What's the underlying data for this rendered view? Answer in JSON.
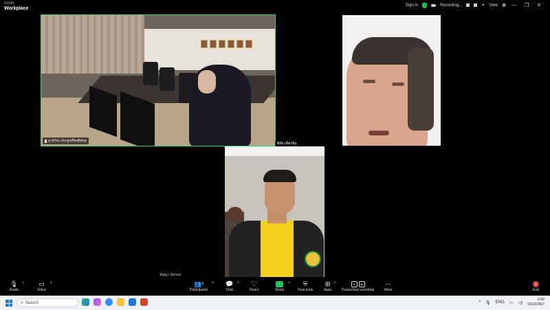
{
  "app": {
    "logo_line1": "zoom",
    "logo_line2": "Workplace"
  },
  "topbar": {
    "sign_in": "Sign in",
    "recording": "Recording...",
    "view": "View",
    "win_min": "—",
    "win_max": "❐",
    "win_close": "✕"
  },
  "participants": [
    {
      "name": "นายวิระ ประยูรเกียรติสกุล",
      "muted": true,
      "active_speaker": true
    },
    {
      "name": "พิชัย เพ็ชรจีน",
      "muted": false,
      "active_speaker": false
    },
    {
      "name": "บัญญา อ้อกอน",
      "muted": false,
      "active_speaker": false
    }
  ],
  "toolbar": {
    "audio": "Audio",
    "video": "Video",
    "participants": "Participants",
    "participants_count": "3",
    "chat": "Chat",
    "react": "React",
    "share": "Share",
    "host_tools": "Host tools",
    "apps": "Apps",
    "pause_stop": "Pause/stop recording",
    "more": "More",
    "end": "End"
  },
  "taskbar": {
    "search_placeholder": "Search",
    "lang": "ENG",
    "time": "5:56",
    "date": "16/12/2567"
  },
  "colors": {
    "active_border": "#2bd46b",
    "share_green": "#1fbf5a",
    "end_red": "#e03a3a",
    "windows_blue": "#1f78d6"
  }
}
